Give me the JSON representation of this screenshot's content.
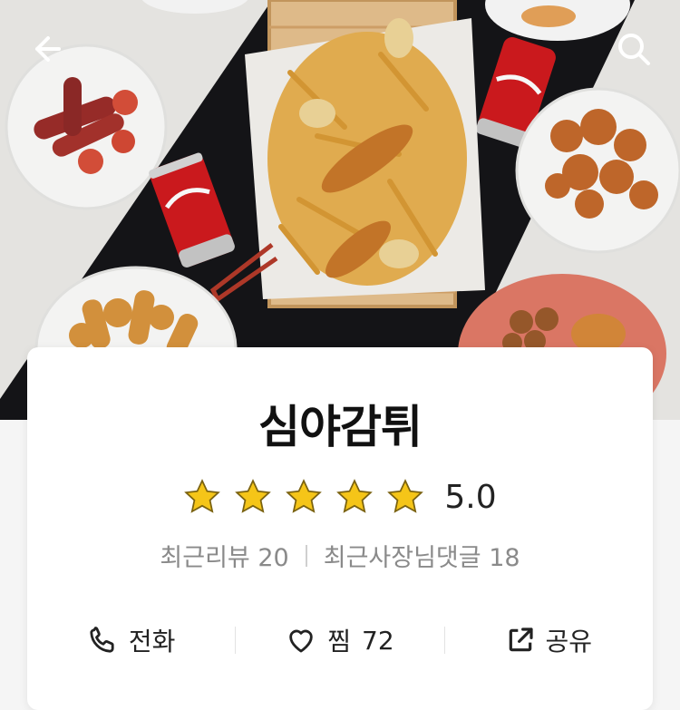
{
  "header": {
    "back_icon": "arrow-left-icon",
    "search_icon": "search-icon"
  },
  "restaurant": {
    "name": "심야감튀",
    "rating": {
      "stars_filled": 5,
      "stars_total": 5,
      "score": "5.0"
    },
    "recent_reviews_label": "최근리뷰",
    "recent_reviews_count": "20",
    "owner_replies_label": "최근사장님댓글",
    "owner_replies_count": "18"
  },
  "actions": {
    "call_label": "전화",
    "like_label": "찜",
    "like_count": "72",
    "share_label": "공유"
  },
  "colors": {
    "star": "#f5c518",
    "card_bg": "#ffffff",
    "meta_text": "#8a8a8a"
  }
}
